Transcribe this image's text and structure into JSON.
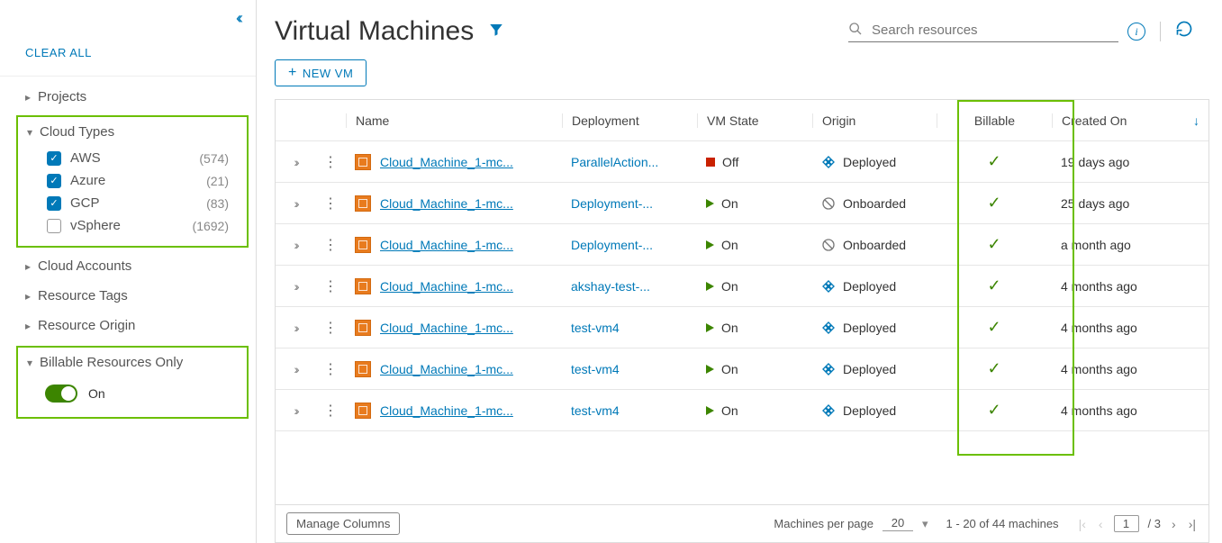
{
  "sidebar": {
    "clear_all": "CLEAR ALL",
    "groups": {
      "projects": "Projects",
      "cloud_types": "Cloud Types",
      "cloud_accounts": "Cloud Accounts",
      "resource_tags": "Resource Tags",
      "resource_origin": "Resource Origin",
      "billable_only": "Billable Resources Only"
    },
    "cloud_types": [
      {
        "label": "AWS",
        "count": "(574)",
        "checked": true
      },
      {
        "label": "Azure",
        "count": "(21)",
        "checked": true
      },
      {
        "label": "GCP",
        "count": "(83)",
        "checked": true
      },
      {
        "label": "vSphere",
        "count": "(1692)",
        "checked": false
      }
    ],
    "billable_toggle": "On"
  },
  "header": {
    "title": "Virtual Machines",
    "search_placeholder": "Search resources",
    "new_vm": "NEW VM"
  },
  "table": {
    "columns": {
      "name": "Name",
      "deployment": "Deployment",
      "state": "VM State",
      "origin": "Origin",
      "billable": "Billable",
      "created": "Created On"
    },
    "rows": [
      {
        "name": "Cloud_Machine_1-mc...",
        "deployment": "ParallelAction...",
        "state": "Off",
        "origin": "Deployed",
        "origin_icon": "deployed",
        "created": "19 days ago"
      },
      {
        "name": "Cloud_Machine_1-mc...",
        "deployment": "Deployment-...",
        "state": "On",
        "origin": "Onboarded",
        "origin_icon": "onboarded",
        "created": "25 days ago"
      },
      {
        "name": "Cloud_Machine_1-mc...",
        "deployment": "Deployment-...",
        "state": "On",
        "origin": "Onboarded",
        "origin_icon": "onboarded",
        "created": "a month ago"
      },
      {
        "name": "Cloud_Machine_1-mc...",
        "deployment": "akshay-test-...",
        "state": "On",
        "origin": "Deployed",
        "origin_icon": "deployed",
        "created": "4 months ago"
      },
      {
        "name": "Cloud_Machine_1-mc...",
        "deployment": "test-vm4",
        "state": "On",
        "origin": "Deployed",
        "origin_icon": "deployed",
        "created": "4 months ago"
      },
      {
        "name": "Cloud_Machine_1-mc...",
        "deployment": "test-vm4",
        "state": "On",
        "origin": "Deployed",
        "origin_icon": "deployed",
        "created": "4 months ago"
      },
      {
        "name": "Cloud_Machine_1-mc...",
        "deployment": "test-vm4",
        "state": "On",
        "origin": "Deployed",
        "origin_icon": "deployed",
        "created": "4 months ago"
      }
    ]
  },
  "footer": {
    "manage": "Manage Columns",
    "per_page_label": "Machines per page",
    "per_page": "20",
    "range": "1 - 20 of 44 machines",
    "page": "1",
    "total_pages": "/ 3"
  }
}
